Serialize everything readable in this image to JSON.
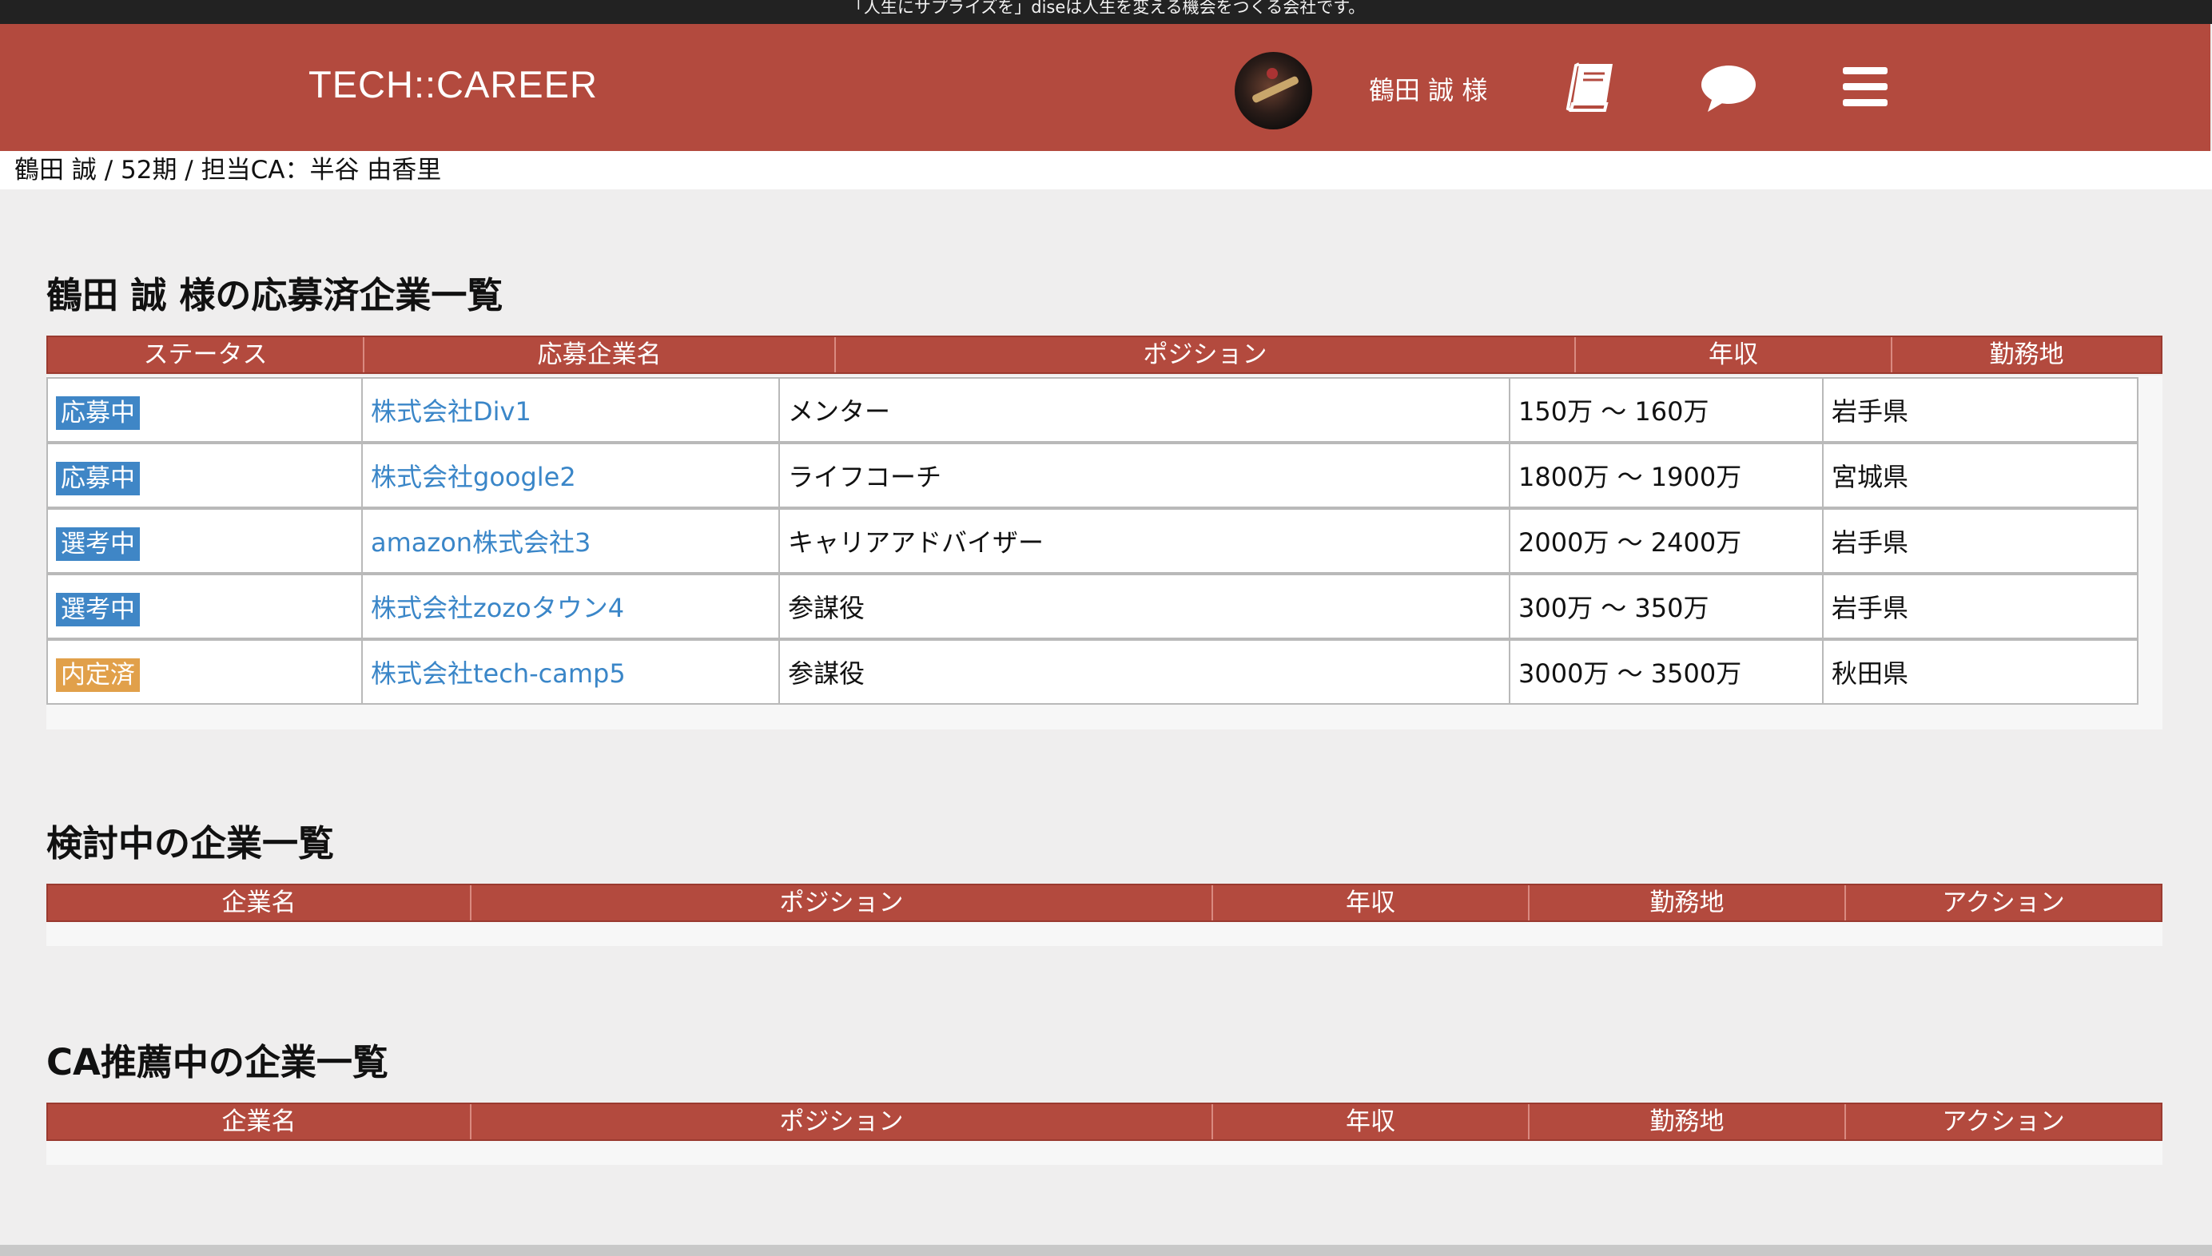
{
  "topbar": {
    "text": "「人生にサプライズを」diseは人生を変える機会をつくる会社です。"
  },
  "header": {
    "logo": "TECH::CAREER",
    "username": "鶴田 誠 様",
    "icons": [
      "book-icon",
      "chat-icon",
      "menu-icon"
    ]
  },
  "info": {
    "text": "鶴田 誠 / 52期 / 担当CA：半谷 由香里"
  },
  "applied": {
    "title": "鶴田 誠 様の応募済企業一覧",
    "headers": [
      "ステータス",
      "応募企業名",
      "ポジション",
      "年収",
      "勤務地"
    ],
    "rows": [
      {
        "status": "応募中",
        "status_color": "#3f86c6",
        "company": "株式会社Div1",
        "position": "メンター",
        "salary": "150万 〜 160万",
        "location": "岩手県"
      },
      {
        "status": "応募中",
        "status_color": "#3f86c6",
        "company": "株式会社google2",
        "position": "ライフコーチ",
        "salary": "1800万 〜 1900万",
        "location": "宮城県"
      },
      {
        "status": "選考中",
        "status_color": "#3f86c6",
        "company": "amazon株式会社3",
        "position": "キャリアアドバイザー",
        "salary": "2000万 〜 2400万",
        "location": "岩手県"
      },
      {
        "status": "選考中",
        "status_color": "#3f86c6",
        "company": "株式会社zozoタウン4",
        "position": "参謀役",
        "salary": "300万 〜 350万",
        "location": "岩手県"
      },
      {
        "status": "内定済",
        "status_color": "#e1a04a",
        "company": "株式会社tech-camp5",
        "position": "参謀役",
        "salary": "3000万 〜 3500万",
        "location": "秋田県"
      }
    ]
  },
  "considering": {
    "title": "検討中の企業一覧",
    "headers": [
      "企業名",
      "ポジション",
      "年収",
      "勤務地",
      "アクション"
    ]
  },
  "recommended": {
    "title": "CA推薦中の企業一覧",
    "headers": [
      "企業名",
      "ポジション",
      "年収",
      "勤務地",
      "アクション"
    ]
  },
  "colors": {
    "header_bg": "#b34a3e",
    "link": "#3a86c8",
    "badge_blue": "#3f86c6",
    "badge_orange": "#e1a04a"
  }
}
